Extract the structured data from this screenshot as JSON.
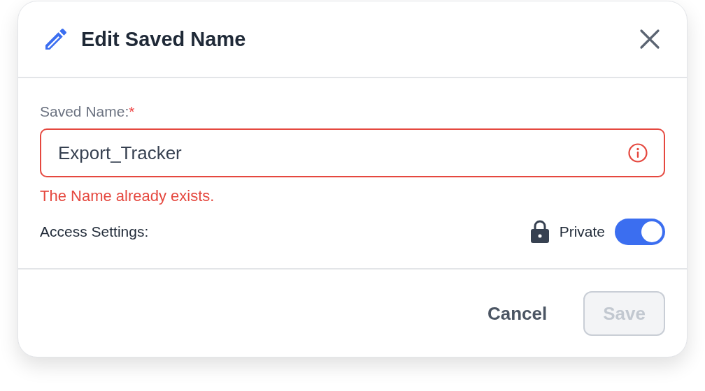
{
  "dialog": {
    "title": "Edit Saved Name"
  },
  "field": {
    "label": "Saved Name:",
    "required_mark": "*",
    "value": "Export_Tracker",
    "invalid": true,
    "error": "The Name already exists."
  },
  "access": {
    "label": "Access Settings:",
    "option": "Private",
    "on": true
  },
  "buttons": [
    {
      "label": "Cancel",
      "kind": "text",
      "disabled": false
    },
    {
      "label": "Save",
      "kind": "outlined",
      "disabled": true
    }
  ]
}
